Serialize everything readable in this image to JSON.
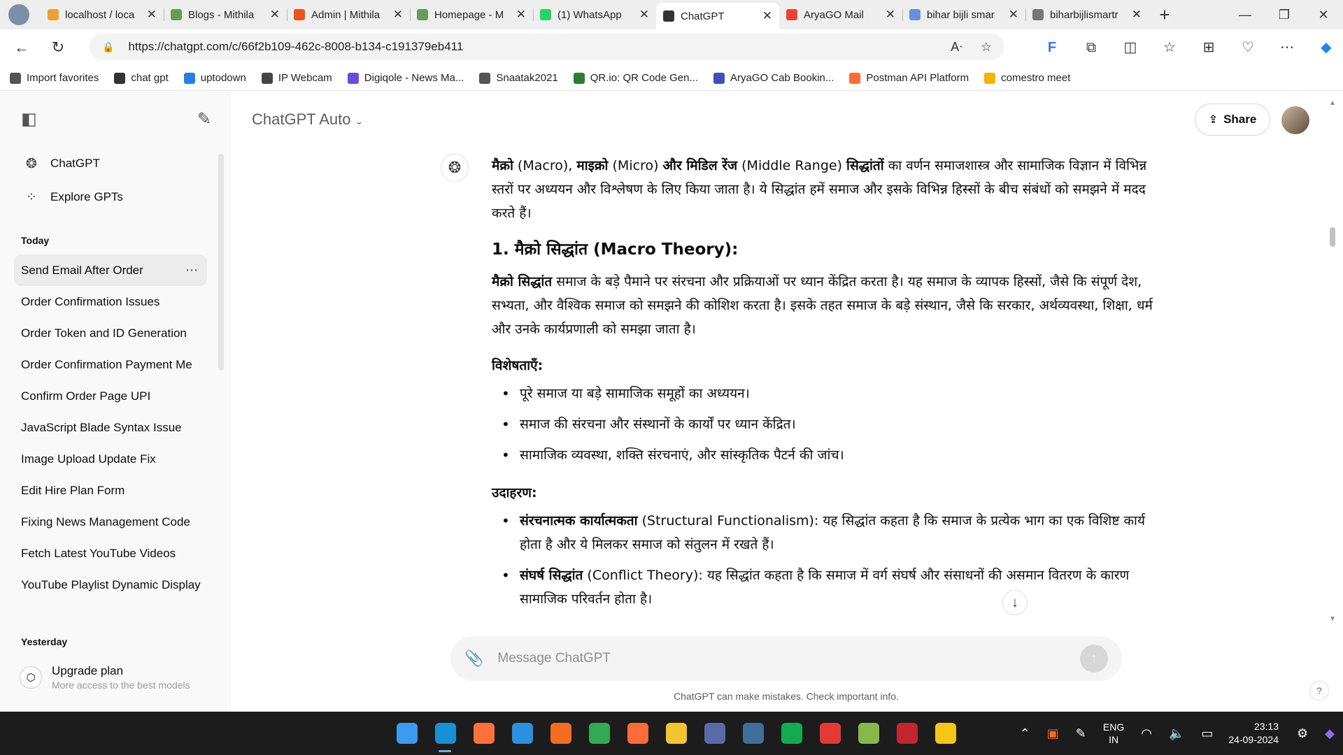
{
  "browser": {
    "tabs": [
      {
        "title": "localhost / loca",
        "icon": "phpmyadmin-icon",
        "color": "#f0a030"
      },
      {
        "title": "Blogs - Mithila",
        "icon": "blog-icon",
        "color": "#6a9a5a"
      },
      {
        "title": "Admin | Mithila",
        "icon": "admin-icon",
        "color": "#e8541e"
      },
      {
        "title": "Homepage - M",
        "icon": "homepage-icon",
        "color": "#6a9a5a"
      },
      {
        "title": "(1) WhatsApp",
        "icon": "whatsapp-icon",
        "color": "#25d366"
      },
      {
        "title": "ChatGPT",
        "icon": "chatgpt-icon",
        "color": "#333333",
        "active": true
      },
      {
        "title": "AryaGO Mail",
        "icon": "gmail-icon",
        "color": "#ea4335"
      },
      {
        "title": "bihar bijli smar",
        "icon": "search-icon",
        "color": "#6b8fd6"
      },
      {
        "title": "biharbijlismartr",
        "icon": "page-icon",
        "color": "#777777"
      }
    ],
    "url": "https://chatgpt.com/c/66f2b109-462c-8008-b134-c191379eb411",
    "favorites": [
      {
        "label": "Import favorites",
        "icon": "import-icon"
      },
      {
        "label": "chat gpt",
        "icon": "chatgpt-icon"
      },
      {
        "label": "uptodown",
        "icon": "uptodown-icon"
      },
      {
        "label": "IP Webcam",
        "icon": "webcam-icon"
      },
      {
        "label": "Digiqole - News Ma...",
        "icon": "digiqole-icon"
      },
      {
        "label": "Snaatak2021",
        "icon": "page-icon"
      },
      {
        "label": "QR.io: QR Code Gen...",
        "icon": "qr-icon"
      },
      {
        "label": "AryaGO Cab Bookin...",
        "icon": "doc-icon"
      },
      {
        "label": "Postman API Platform",
        "icon": "postman-icon"
      },
      {
        "label": "comestro meet",
        "icon": "meet-icon"
      }
    ]
  },
  "sidebar": {
    "nav": [
      {
        "label": "ChatGPT",
        "icon": "chatgpt-icon"
      },
      {
        "label": "Explore GPTs",
        "icon": "grid-icon"
      }
    ],
    "today_label": "Today",
    "history": [
      "Send Email After Order",
      "Order Confirmation Issues",
      "Order Token and ID Generation",
      "Order Confirmation Payment Me",
      "Confirm Order Page UPI",
      "JavaScript Blade Syntax Issue",
      "Image Upload Update Fix",
      "Edit Hire Plan Form",
      "Fixing News Management Code",
      "Fetch Latest YouTube Videos",
      "YouTube Playlist Dynamic Display"
    ],
    "yesterday_label": "Yesterday",
    "upgrade": {
      "title": "Upgrade plan",
      "subtitle": "More access to the best models"
    }
  },
  "header": {
    "model": "ChatGPT Auto",
    "share": "Share"
  },
  "message": {
    "intro_bold1": "मैक्रो",
    "intro_t1": " (Macro), ",
    "intro_bold2": "माइक्रो",
    "intro_t2": " (Micro) ",
    "intro_bold3": "और मिडिल रेंज",
    "intro_t3": " (Middle Range) ",
    "intro_bold4": "सिद्धांतों",
    "intro_t4": " का वर्णन समाजशास्त्र और सामाजिक विज्ञान में विभिन्न स्तरों पर अध्ययन और विश्लेषण के लिए किया जाता है। ये सिद्धांत हमें समाज और इसके विभिन्न हिस्सों के बीच संबंधों को समझने में मदद करते हैं।",
    "heading": "1. मैक्रो सिद्धांत (Macro Theory):",
    "macro_bold": "मैक्रो सिद्धांत",
    "macro_text": " समाज के बड़े पैमाने पर संरचना और प्रक्रियाओं पर ध्यान केंद्रित करता है। यह समाज के व्यापक हिस्सों, जैसे कि संपूर्ण देश, सभ्यता, और वैश्विक समाज को समझने की कोशिश करता है। इसके तहत समाज के बड़े संस्थान, जैसे कि सरकार, अर्थव्यवस्था, शिक्षा, धर्म और उनके कार्यप्रणाली को समझा जाता है।",
    "features_label": "विशेषताएँ:",
    "features": [
      "पूरे समाज या बड़े सामाजिक समूहों का अध्ययन।",
      "समाज की संरचना और संस्थानों के कार्यों पर ध्यान केंद्रित।",
      "सामाजिक व्यवस्था, शक्ति संरचनाएं, और सांस्कृतिक पैटर्न की जांच।"
    ],
    "examples_label": "उदाहरण:",
    "examples": [
      {
        "bold": "संरचनात्मक कार्यात्मकता",
        "term": " (Structural Functionalism): ",
        "text": "यह सिद्धांत कहता है कि समाज के प्रत्येक भाग का एक विशिष्ट कार्य होता है और ये मिलकर समाज को संतुलन में रखते हैं।"
      },
      {
        "bold": "संघर्ष सिद्धांत",
        "term": " (Conflict Theory): ",
        "text": "यह सिद्धांत कहता है कि समाज में वर्ग संघर्ष और संसाधनों की असमान वितरण के कारण सामाजिक परिवर्तन होता है।"
      }
    ]
  },
  "composer": {
    "placeholder": "Message ChatGPT"
  },
  "disclaimer": "ChatGPT can make mistakes. Check important info.",
  "taskbar": {
    "apps": [
      {
        "icon": "windows-start-icon",
        "color": "#3a9bf0"
      },
      {
        "icon": "edge-icon",
        "color": "#1a8fd6",
        "active": true
      },
      {
        "icon": "firefox-icon",
        "color": "#ff7139"
      },
      {
        "icon": "vscode-icon",
        "color": "#2d8fe0"
      },
      {
        "icon": "xampp-icon",
        "color": "#f36d20"
      },
      {
        "icon": "chrome-icon",
        "color": "#34a853"
      },
      {
        "icon": "postman-icon",
        "color": "#ff6c37"
      },
      {
        "icon": "file-explorer-icon",
        "color": "#f3c431"
      },
      {
        "icon": "store-icon",
        "color": "#5a6aa8"
      },
      {
        "icon": "mysql-workbench-icon",
        "color": "#3f6e9a"
      },
      {
        "icon": "mongodb-compass-icon",
        "color": "#13aa52"
      },
      {
        "icon": "anydesk-icon",
        "color": "#e53935"
      },
      {
        "icon": "notepadpp-icon",
        "color": "#86b84a"
      },
      {
        "icon": "filezilla-icon",
        "color": "#c1272d"
      },
      {
        "icon": "sticky-notes-icon",
        "color": "#f5c518"
      }
    ],
    "lang_top": "ENG",
    "lang_bottom": "IN",
    "time": "23:13",
    "date": "24-09-2024"
  }
}
